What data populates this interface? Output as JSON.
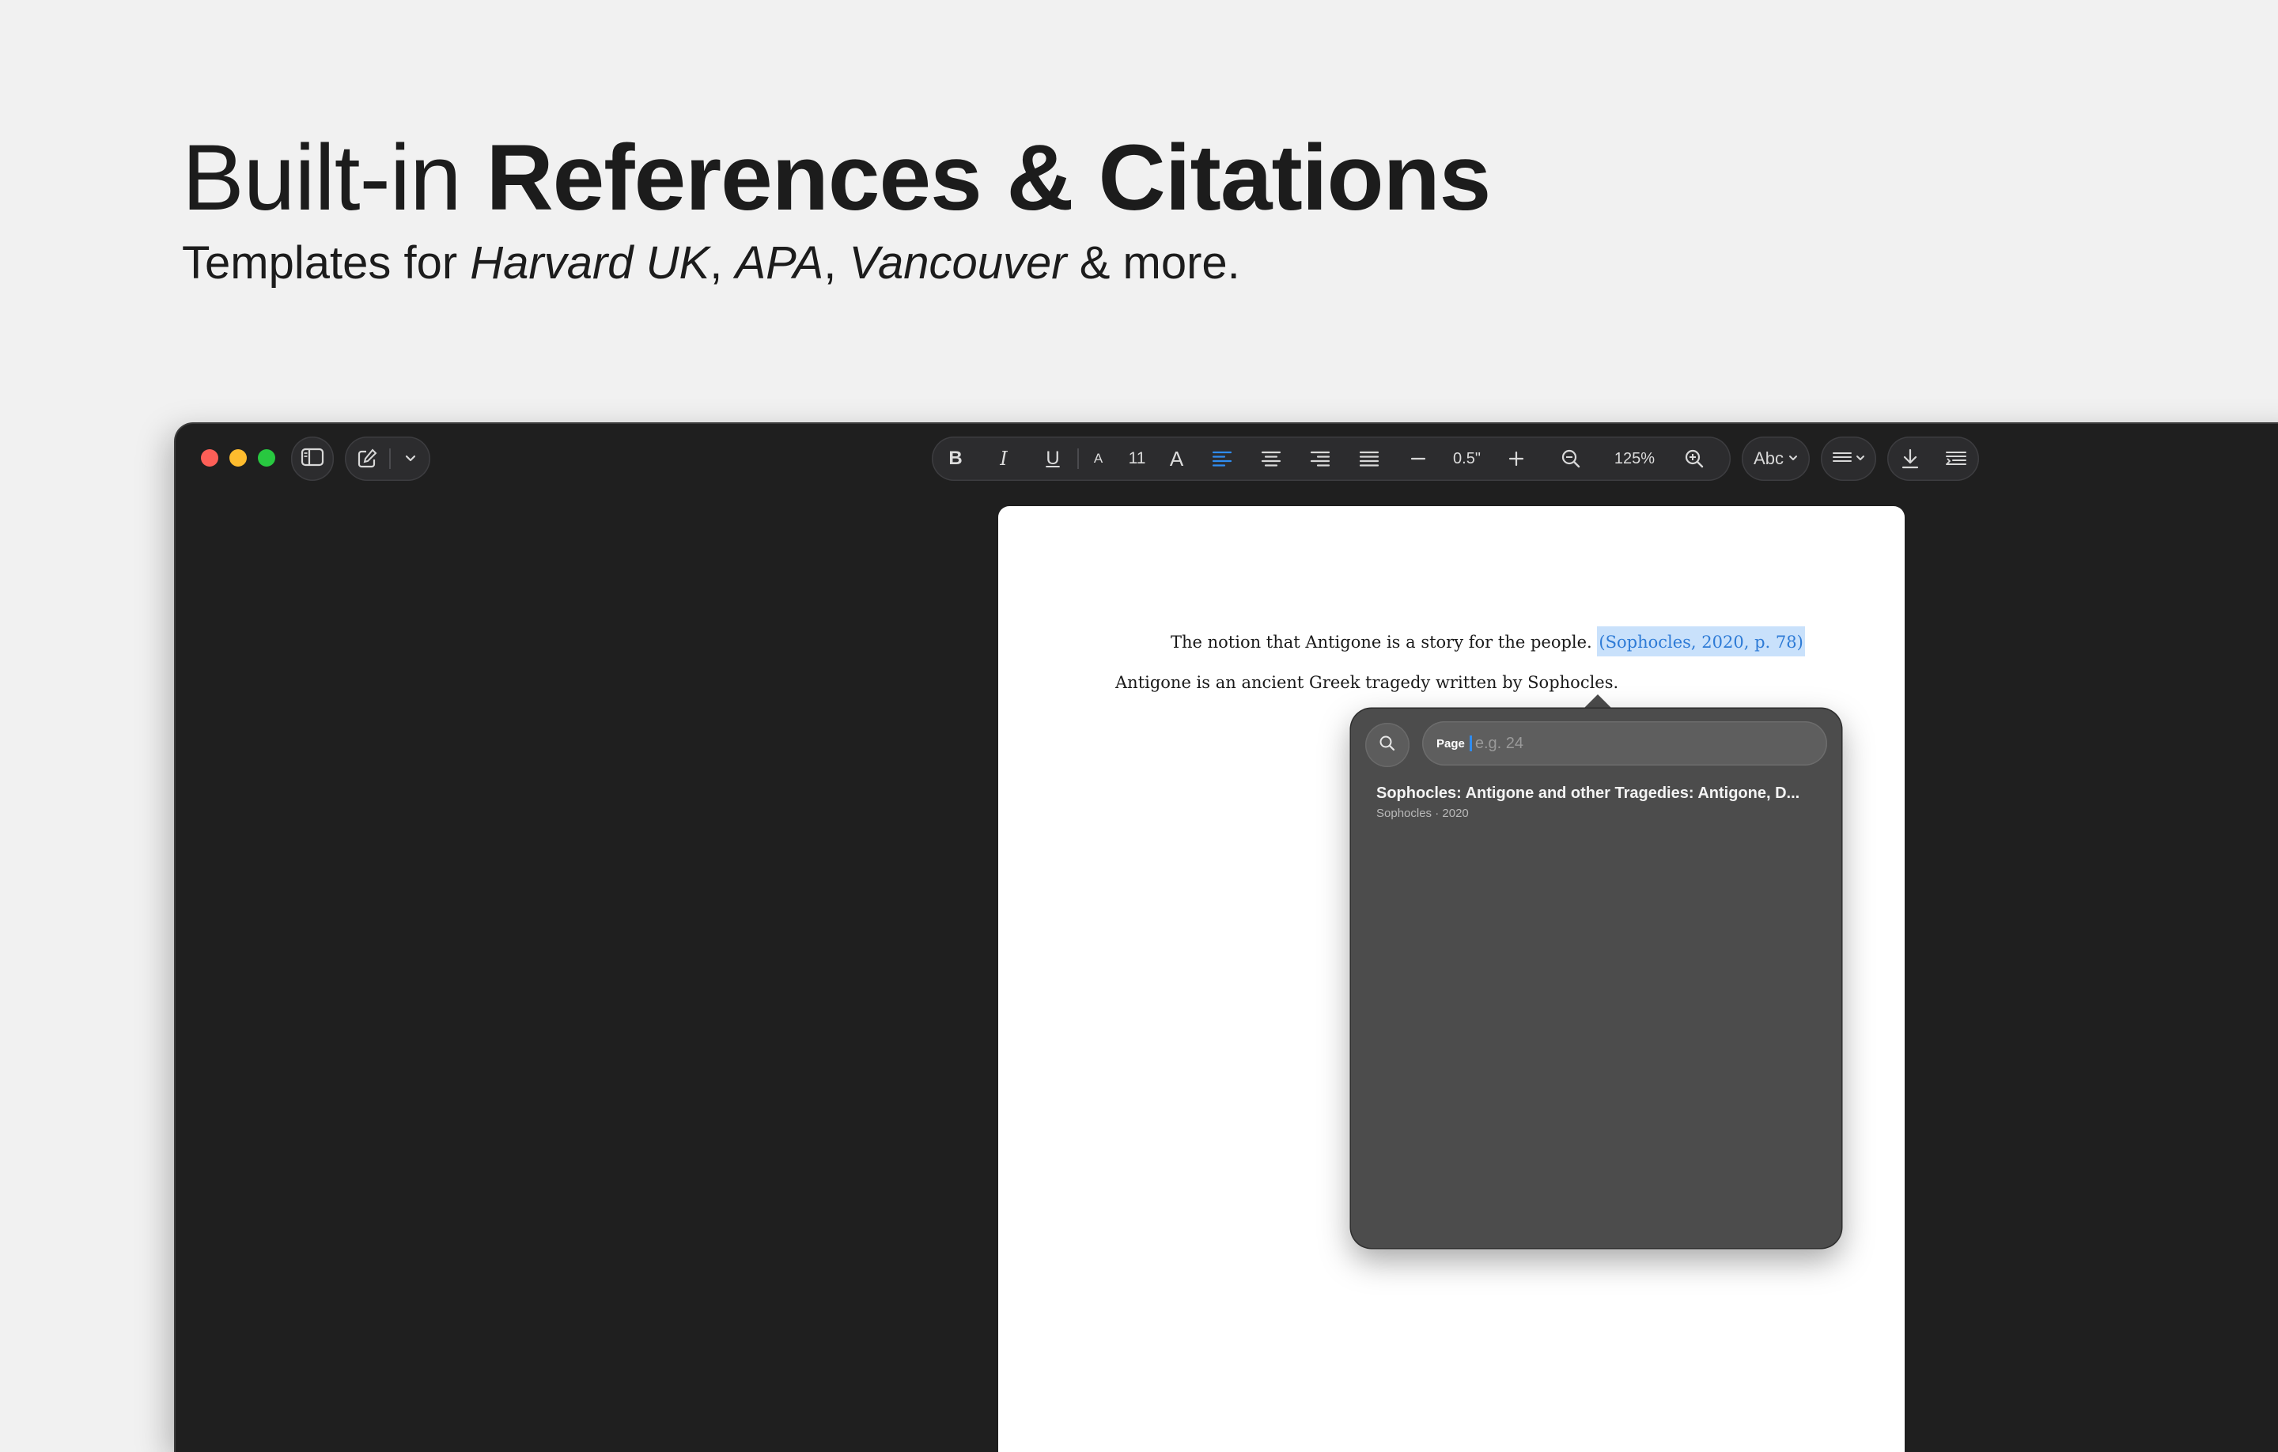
{
  "hero": {
    "title_prefix": "Built-in ",
    "title_bold": "References & Citations",
    "subtitle_prefix": "Templates for ",
    "style1": "Harvard UK",
    "comma1": ", ",
    "style2": "APA",
    "comma2": ", ",
    "style3": "Vancouver",
    "subtitle_suffix": " & more."
  },
  "toolbar": {
    "bold": "B",
    "italic": "I",
    "underline": "U",
    "font_smaller": "A",
    "font_size": "11",
    "font_larger": "A",
    "spacing_value": "0.5\"",
    "zoom_value": "125%",
    "spelling_label": "Abc"
  },
  "document": {
    "line1_text": "The notion that Antigone is a story for the people. ",
    "line1_citation": "(Sophocles, 2020, p. 78)",
    "line2_text": "Antigone is an ancient Greek tragedy written by Sophocles."
  },
  "citation_popover": {
    "page_label": "Page",
    "page_placeholder": "e.g. 24",
    "results": [
      {
        "title": "Sophocles: Antigone and other Tragedies: Antigone, D...",
        "subtitle": "Sophocles · 2020"
      }
    ]
  },
  "colors": {
    "accent": "#2f8cf0",
    "citation_highlight": "#c9e1fb",
    "citation_text": "#2e7bd6",
    "window_bg": "#1f1f1f",
    "popover_bg": "#4c4c4c"
  }
}
